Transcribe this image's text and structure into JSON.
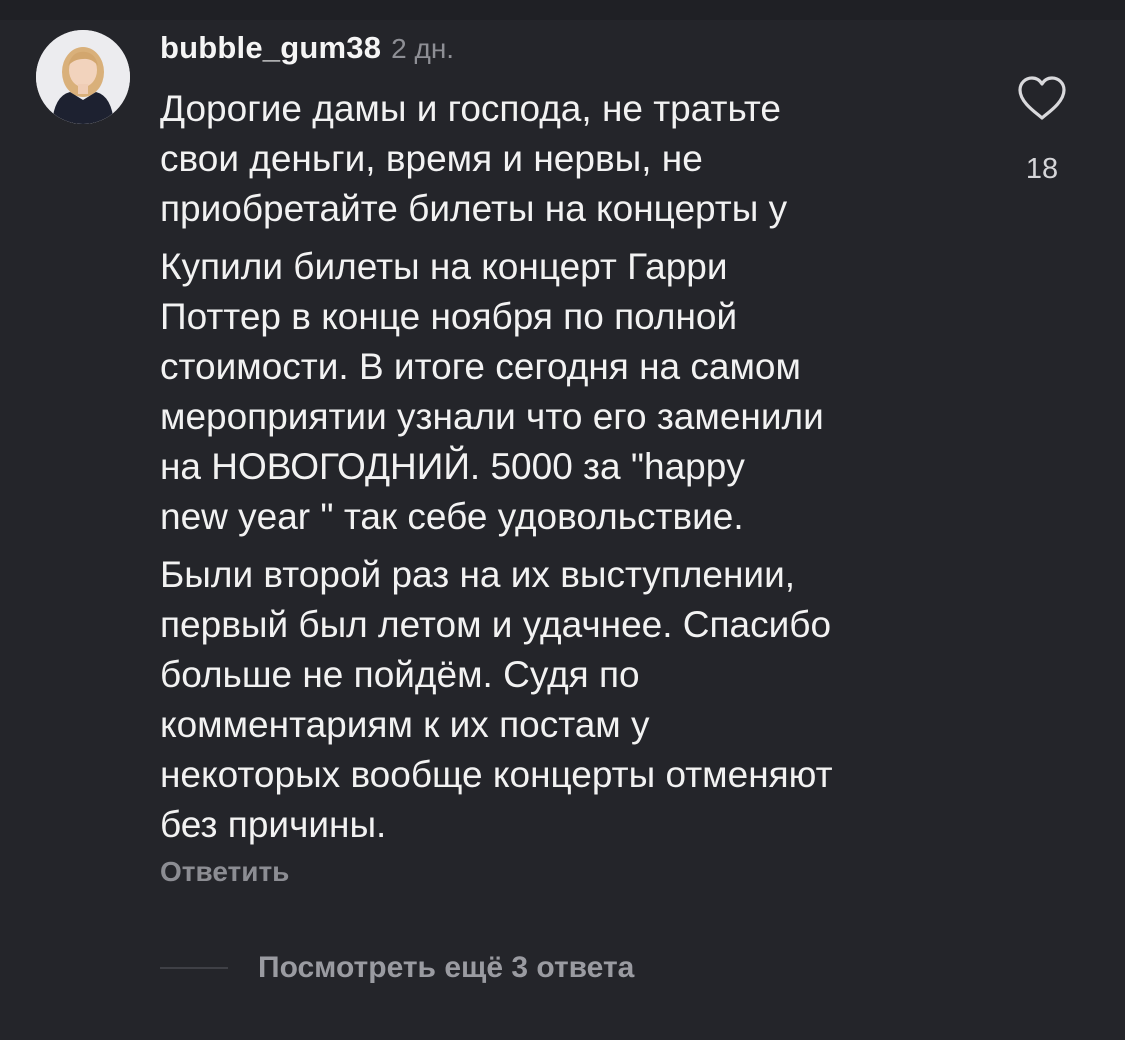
{
  "comment": {
    "username": "bubble_gum38",
    "time": "2 дн.",
    "paragraphs": [
      "Дорогие дамы и господа, не тратьте\nсвои деньги, время и нервы, не\nприобретайте билеты на концерты у",
      "Купили билеты на концерт Гарри\nПоттер в конце ноября по полной\nстоимости. В итоге сегодня на самом\nмероприятии узнали что его заменили\nна НОВОГОДНИЙ.  5000  за \"happy\nnew year \" так себе  удовольствие.",
      "Были второй раз на их выступлении,\nпервый был летом и удачнее. Спасибо\nбольше не пойдём. Судя по\nкомментариям к их постам у\nнекоторых вообще концерты отменяют\nбез причины."
    ],
    "reply_label": "Ответить",
    "likes": "18",
    "like_icon": "heart-outline-icon",
    "more_replies_label": "Посмотреть ещё 3 ответа"
  },
  "colors": {
    "background": "#24252a",
    "text": "#f2f2f2",
    "muted": "#8e8f95"
  }
}
